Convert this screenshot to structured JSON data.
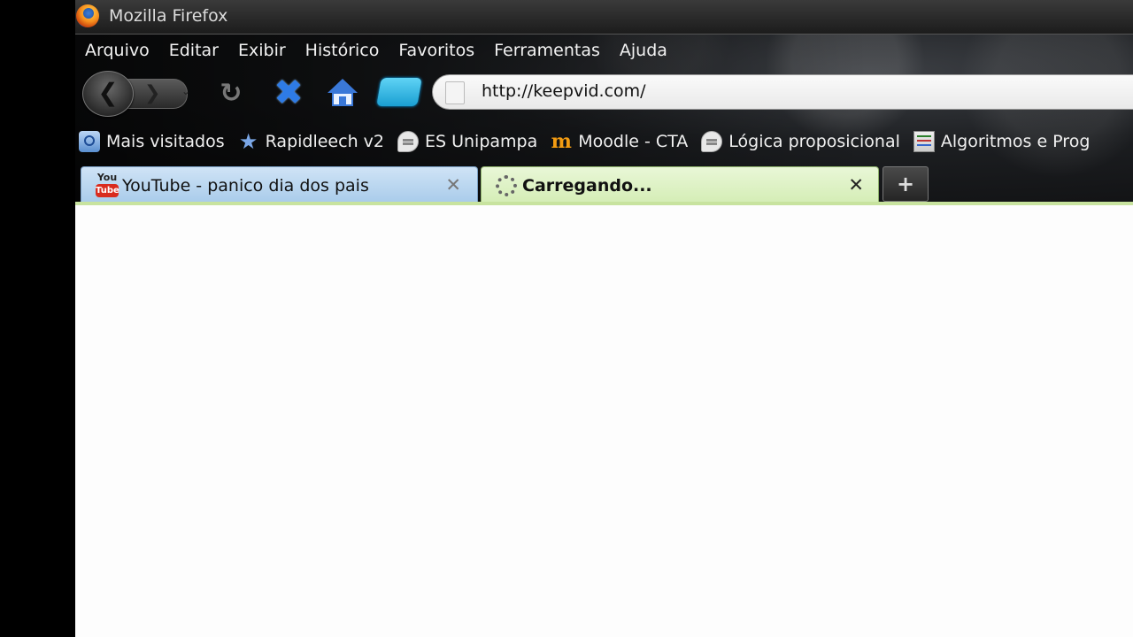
{
  "window": {
    "title": "Mozilla Firefox"
  },
  "menu": {
    "items": [
      {
        "label": "Arquivo"
      },
      {
        "label": "Editar"
      },
      {
        "label": "Exibir"
      },
      {
        "label": "Histórico"
      },
      {
        "label": "Favoritos"
      },
      {
        "label": "Ferramentas"
      },
      {
        "label": "Ajuda"
      }
    ]
  },
  "nav": {
    "back_glyph": "❮",
    "forward_glyph": "❯",
    "dropdown_glyph": "⌄",
    "reload_glyph": "↻",
    "stop_glyph": "✖",
    "url": "http://keepvid.com/"
  },
  "bookmarks": {
    "items": [
      {
        "label": "Mais visitados",
        "icon": "page-search-icon"
      },
      {
        "label": "Rapidleech v2",
        "icon": "star-icon"
      },
      {
        "label": "ES Unipampa",
        "icon": "chat-bubble-icon"
      },
      {
        "label": "Moodle - CTA",
        "icon": "moodle-icon"
      },
      {
        "label": "Lógica proposicional",
        "icon": "chat-bubble-icon"
      },
      {
        "label": "Algoritmos e Prog",
        "icon": "calendar-list-icon"
      }
    ]
  },
  "tabs": [
    {
      "label": "YouTube - panico dia dos pais",
      "icon": "youtube-icon",
      "icon_top": "You",
      "icon_bottom": "Tube",
      "close": "✕",
      "active": false
    },
    {
      "label": "Carregando...",
      "icon": "loading-spinner-icon",
      "close": "✕",
      "active": true
    }
  ],
  "new_tab": {
    "glyph": "+"
  },
  "colors": {
    "active_tab": "#d4edb5",
    "inactive_tab": "#a8cbea",
    "stop_blue": "#2e7be6",
    "content_bg": "#fdfdfd"
  }
}
